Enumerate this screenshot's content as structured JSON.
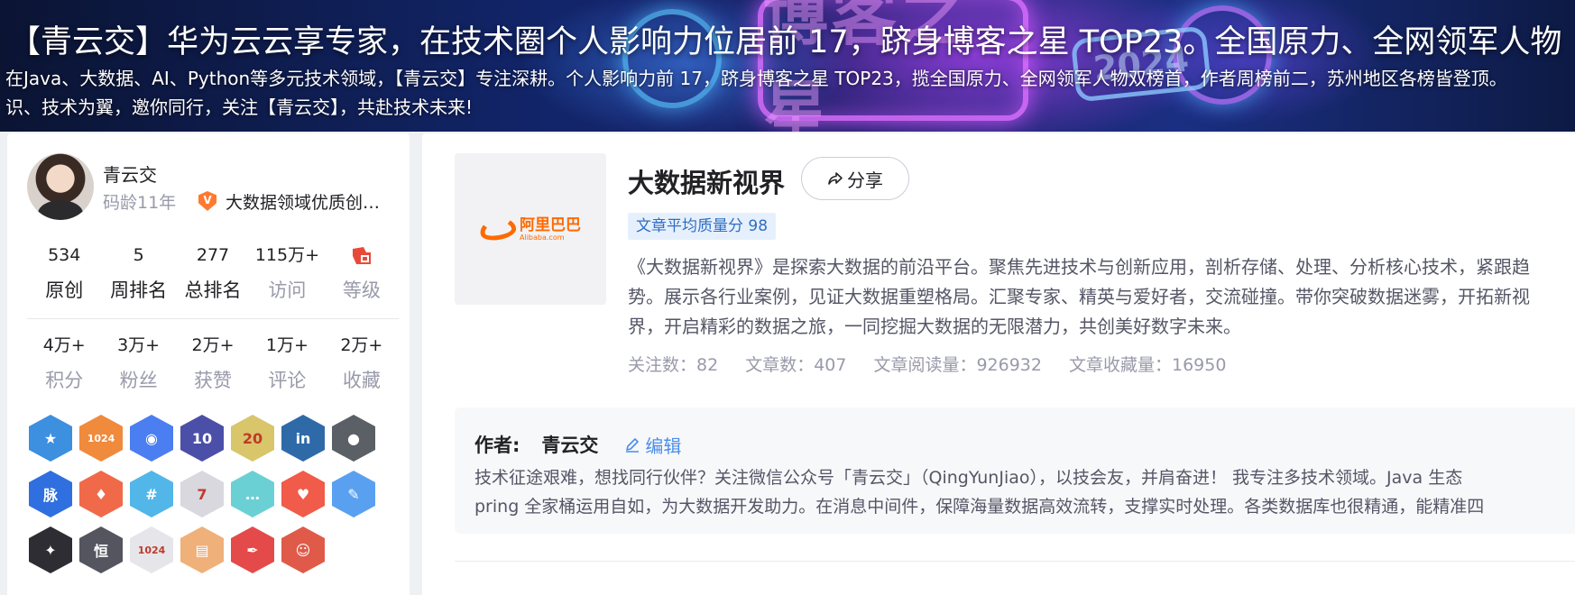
{
  "banner": {
    "title": "【青云交】华为云云享专家，在技术圈个人影响力位居前 17，跻身博客之星 TOP23。全国原力、全网领军人物",
    "desc_line1": "在Java、大数据、AI、Python等多元技术领域，【青云交】专注深耕。个人影响力前 17，跻身博客之星 TOP23，揽全国原力、全网领军人物双榜首，作者周榜前二，苏州地区各榜皆登顶。",
    "desc_line2": "识、技术为翼，邀你同行，关注【青云交】，共赴技术未来!",
    "art_text": "博客之星",
    "art_year": "2024"
  },
  "profile": {
    "username": "青云交",
    "code_age": "码龄11年",
    "cert_icon": "verified-v-icon",
    "cert_text": "大数据领域优质创作者",
    "stats_row1": [
      {
        "value": "534",
        "label": "原创",
        "muted": false
      },
      {
        "value": "5",
        "label": "周排名",
        "muted": false
      },
      {
        "value": "277",
        "label": "总排名",
        "muted": false
      },
      {
        "value": "115万+",
        "label": "访问",
        "muted": true
      },
      {
        "value": "",
        "label": "等级",
        "muted": true
      }
    ],
    "stats_row2": [
      {
        "value": "4万+",
        "label": "积分"
      },
      {
        "value": "3万+",
        "label": "粉丝"
      },
      {
        "value": "2万+",
        "label": "获赞"
      },
      {
        "value": "1万+",
        "label": "评论"
      },
      {
        "value": "2万+",
        "label": "收藏"
      }
    ],
    "level_icon": "level-blog-icon",
    "badges": [
      {
        "icon": "star-badge-icon",
        "color": "#3d8fe0",
        "text": "★"
      },
      {
        "icon": "1024-badge-icon",
        "color": "#f08a3c",
        "text": "1024"
      },
      {
        "icon": "planet-badge-icon",
        "color": "#4b7ef0",
        "text": "◉"
      },
      {
        "icon": "anniversary-badge-icon",
        "color": "#4b4fa8",
        "text": "10"
      },
      {
        "icon": "20-badge-icon",
        "color": "#d9c56a",
        "text": "20"
      },
      {
        "icon": "linkedin-badge-icon",
        "color": "#2f6aa8",
        "text": "in"
      },
      {
        "icon": "github-badge-icon",
        "color": "#5b5f66",
        "text": "●"
      },
      {
        "icon": "mai-badge-icon",
        "color": "#2f6fe0",
        "text": "脉"
      },
      {
        "icon": "reward-badge-icon",
        "color": "#f06a4a",
        "text": "♦"
      },
      {
        "icon": "hashtag-badge-icon",
        "color": "#53b6e8",
        "text": "#"
      },
      {
        "icon": "monkey-badge-icon",
        "color": "#d8d8de",
        "text": "7"
      },
      {
        "icon": "chat-badge-icon",
        "color": "#6bd0d4",
        "text": "…"
      },
      {
        "icon": "heart-badge-icon",
        "color": "#f05b4a",
        "text": "♥"
      },
      {
        "icon": "pencil-badge-icon",
        "color": "#5aa0f0",
        "text": "✎"
      },
      {
        "icon": "graduate-badge-icon",
        "color": "#2d2d33",
        "text": "✦"
      },
      {
        "icon": "heng-badge-icon",
        "color": "#555560",
        "text": "恒"
      },
      {
        "icon": "1024-stars-badge-icon",
        "color": "#e6e6ea",
        "text": "1024"
      },
      {
        "icon": "book-badge-icon",
        "color": "#f0b07a",
        "text": "▤"
      },
      {
        "icon": "pen-nib-badge-icon",
        "color": "#e44a4a",
        "text": "✒"
      },
      {
        "icon": "monkey-red-badge-icon",
        "color": "#e05a4a",
        "text": "☺"
      }
    ]
  },
  "column": {
    "logo_text": "阿里巴巴",
    "logo_sub": "Alibaba.com",
    "title": "大数据新视界",
    "share_label": "分享",
    "quality": "文章平均质量分 98",
    "description": "《大数据新视界》是探索大数据的前沿平台。聚焦先进技术与创新应用，剖析存储、处理、分析核心技术，紧跟趋势。展示各行业案例，见证大数据重塑格局。汇聚专家、精英与爱好者，交流碰撞。带你突破数据迷雾，开拓新视界，开启精彩的数据之旅，一同挖掘大数据的无限潜力，共创美好数字未来。",
    "metrics": [
      "关注数：82",
      "文章数：407",
      "文章阅读量：926932",
      "文章收藏量：16950"
    ]
  },
  "author": {
    "label": "作者:",
    "name": "青云交",
    "edit_label": "编辑",
    "desc_line1": "技术征途艰难，想找同行伙伴？关注微信公众号「青云交」（QingYunJiao），以技会友，并肩奋进！ 我专注多技术领域。Java 生态",
    "desc_line2": "pring 全家桶运用自如，为大数据开发助力。在消息中间件，保障海量数据高效流转，支撑实时处理。各类数据库也很精通，能精准四"
  }
}
